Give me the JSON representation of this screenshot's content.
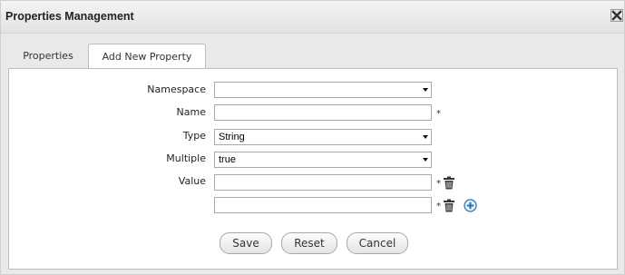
{
  "dialog": {
    "title": "Properties Management",
    "close_icon": "close-icon"
  },
  "tabs": [
    {
      "label": "Properties",
      "active": false
    },
    {
      "label": "Add New Property",
      "active": true
    }
  ],
  "form": {
    "namespace": {
      "label": "Namespace",
      "value": ""
    },
    "name": {
      "label": "Name",
      "value": "",
      "required": "*"
    },
    "type": {
      "label": "Type",
      "value": "String"
    },
    "multiple": {
      "label": "Multiple",
      "value": "true"
    },
    "value": {
      "label": "Value",
      "entries": [
        {
          "value": "",
          "required": "*",
          "icon": "trash-icon"
        },
        {
          "value": "",
          "required": "*",
          "icon": "trash-icon",
          "add_icon": "plus-circle-icon"
        }
      ]
    }
  },
  "buttons": {
    "save": "Save",
    "reset": "Reset",
    "cancel": "Cancel"
  },
  "colors": {
    "add_icon": "#2a6fb0",
    "trash_icon": "#333333"
  }
}
